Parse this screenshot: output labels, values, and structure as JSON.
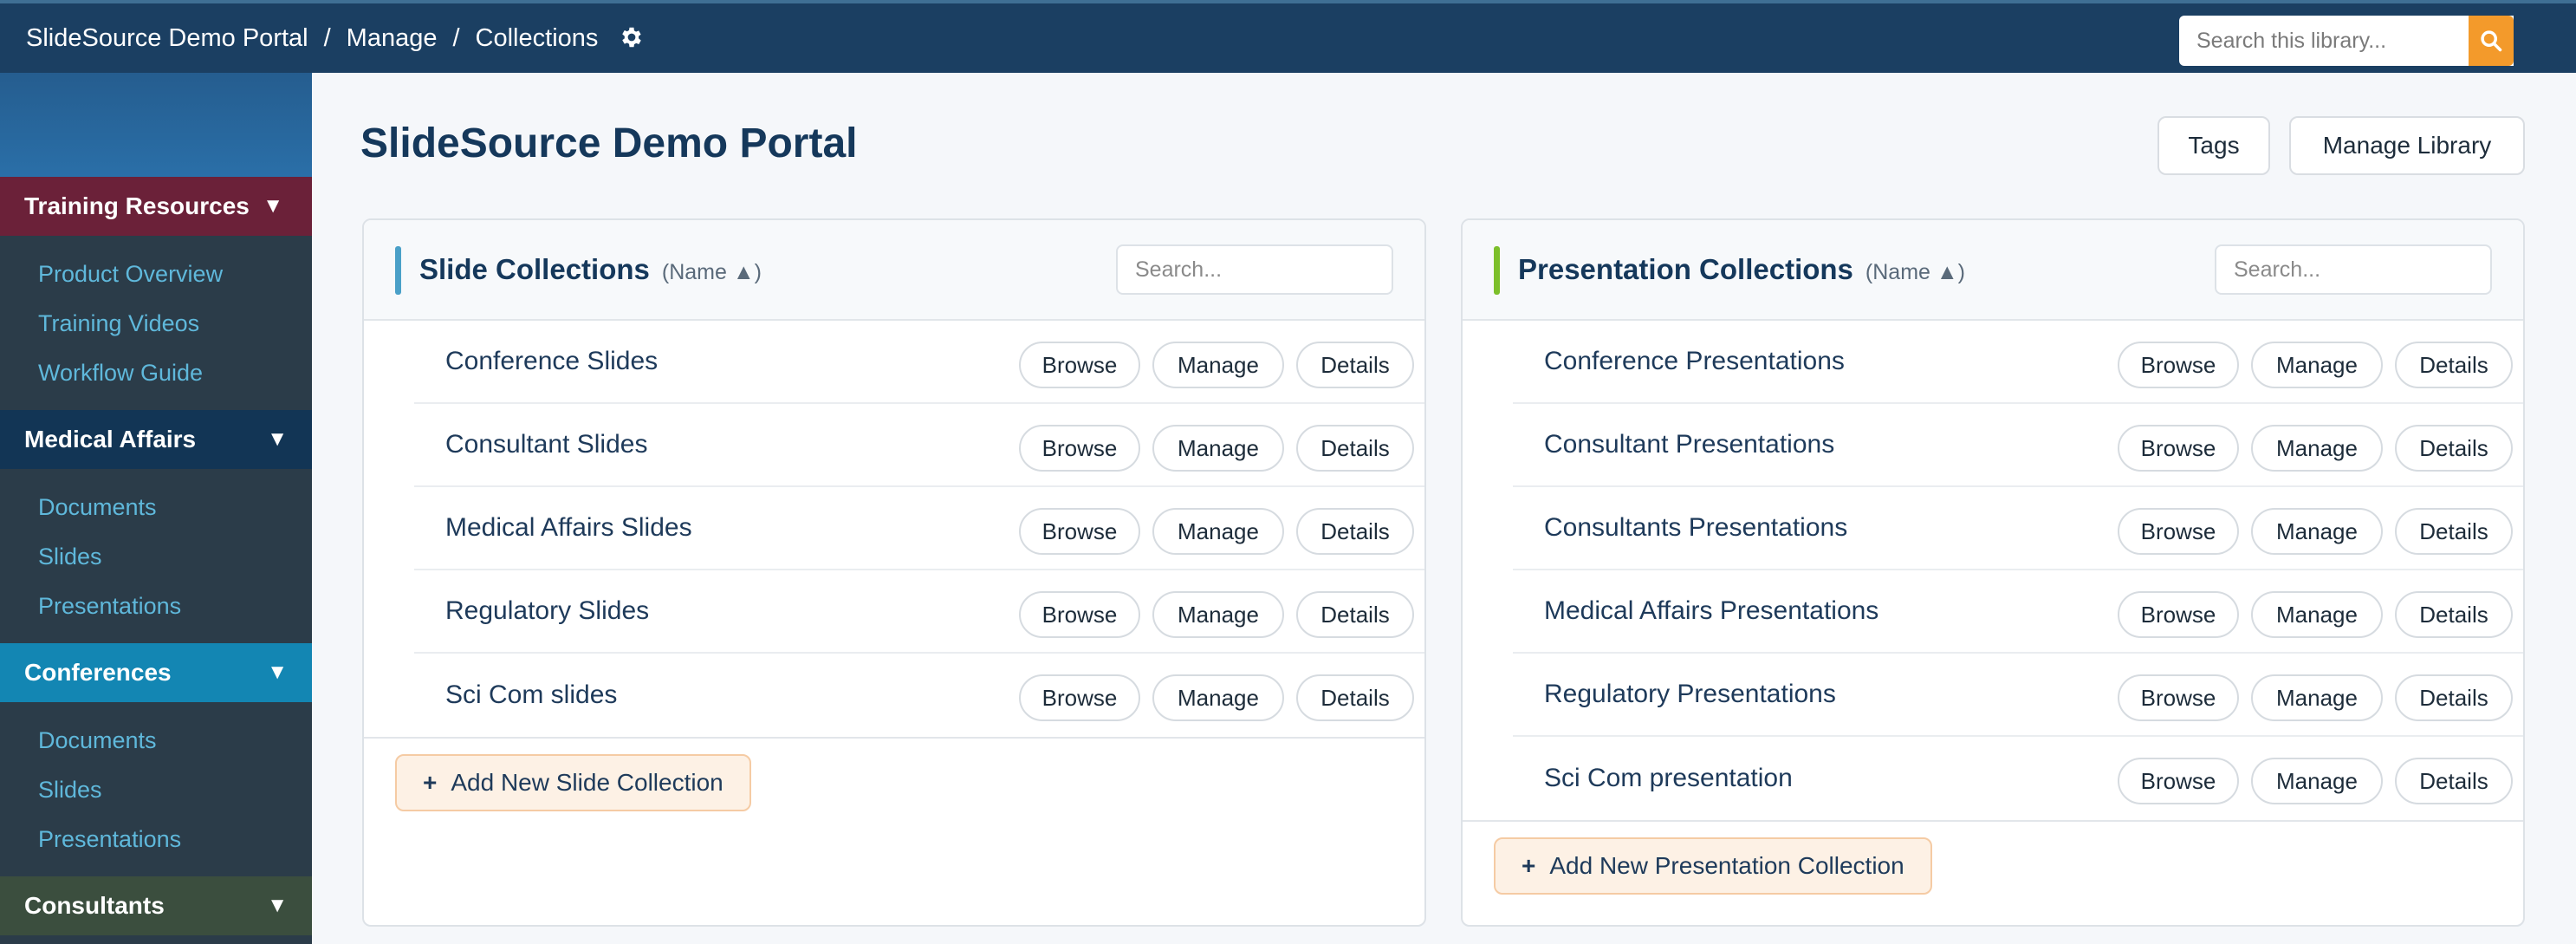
{
  "topbar": {
    "breadcrumb": [
      "SlideSource Demo Portal",
      "Manage",
      "Collections"
    ],
    "separator": "/",
    "search_placeholder": "Search this library...",
    "colors": {
      "bar": "#1b3f62",
      "search_button": "#f39a2b"
    }
  },
  "sidebar": {
    "sections": [
      {
        "label": "Training Resources",
        "items": [
          "Product Overview",
          "Training Videos",
          "Workflow Guide"
        ],
        "color": "#6b2139"
      },
      {
        "label": "Medical Affairs",
        "items": [
          "Documents",
          "Slides",
          "Presentations"
        ],
        "color": "#123555"
      },
      {
        "label": "Conferences",
        "items": [
          "Documents",
          "Slides",
          "Presentations"
        ],
        "color": "#1386b3"
      },
      {
        "label": "Consultants",
        "items": [],
        "color": "#3b4e3e"
      }
    ],
    "chevron": "▼"
  },
  "main": {
    "title": "SlideSource Demo Portal",
    "tags_label": "Tags",
    "manage_library_label": "Manage Library",
    "slide_panel": {
      "title": "Slide Collections",
      "sort": "(Name ▲)",
      "search_placeholder": "Search...",
      "accent": "#4aa0c8",
      "rows": [
        "Conference Slides",
        "Consultant Slides",
        "Medical Affairs Slides",
        "Regulatory Slides",
        "Sci Com slides"
      ],
      "add_label": "Add New Slide Collection"
    },
    "presentation_panel": {
      "title": "Presentation Collections",
      "sort": "(Name ▲)",
      "search_placeholder": "Search...",
      "accent": "#7cbf2a",
      "rows": [
        "Conference Presentations",
        "Consultant Presentations",
        "Consultants Presentations",
        "Medical Affairs Presentations",
        "Regulatory Presentations",
        "Sci Com presentation"
      ],
      "add_label": "Add New Presentation Collection"
    },
    "row_actions": {
      "browse": "Browse",
      "manage": "Manage",
      "details": "Details"
    },
    "add_plus": "+"
  }
}
